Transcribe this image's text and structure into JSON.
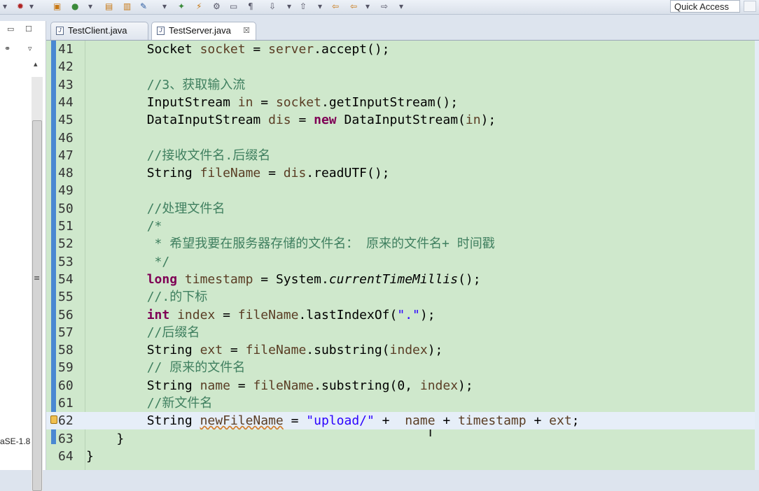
{
  "toolbar": {
    "quick_access": "Quick Access"
  },
  "tabs": [
    {
      "label": "TestClient.java"
    },
    {
      "label": "TestServer.java",
      "close": "☒"
    }
  ],
  "left_panel_text": "aSE-1.8",
  "code_lines": [
    {
      "num": "41",
      "tokens": [
        {
          "t": "        Socket ",
          "c": ""
        },
        {
          "t": "socket",
          "c": "fld"
        },
        {
          "t": " = ",
          "c": ""
        },
        {
          "t": "server",
          "c": "fld"
        },
        {
          "t": ".accept();",
          "c": ""
        }
      ]
    },
    {
      "num": "42",
      "tokens": []
    },
    {
      "num": "43",
      "tokens": [
        {
          "t": "        //3、获取输入流",
          "c": "cm"
        }
      ]
    },
    {
      "num": "44",
      "tokens": [
        {
          "t": "        InputStream ",
          "c": ""
        },
        {
          "t": "in",
          "c": "fld"
        },
        {
          "t": " = ",
          "c": ""
        },
        {
          "t": "socket",
          "c": "fld"
        },
        {
          "t": ".getInputStream();",
          "c": ""
        }
      ]
    },
    {
      "num": "45",
      "tokens": [
        {
          "t": "        DataInputStream ",
          "c": ""
        },
        {
          "t": "dis",
          "c": "fld"
        },
        {
          "t": " = ",
          "c": ""
        },
        {
          "t": "new",
          "c": "kw"
        },
        {
          "t": " DataInputStream(",
          "c": ""
        },
        {
          "t": "in",
          "c": "fld"
        },
        {
          "t": ");",
          "c": ""
        }
      ]
    },
    {
      "num": "46",
      "tokens": []
    },
    {
      "num": "47",
      "tokens": [
        {
          "t": "        //接收文件名.后缀名",
          "c": "cm"
        }
      ]
    },
    {
      "num": "48",
      "tokens": [
        {
          "t": "        String ",
          "c": ""
        },
        {
          "t": "fileName",
          "c": "fld"
        },
        {
          "t": " = ",
          "c": ""
        },
        {
          "t": "dis",
          "c": "fld"
        },
        {
          "t": ".readUTF();",
          "c": ""
        }
      ]
    },
    {
      "num": "49",
      "tokens": []
    },
    {
      "num": "50",
      "tokens": [
        {
          "t": "        //处理文件名",
          "c": "cm"
        }
      ]
    },
    {
      "num": "51",
      "tokens": [
        {
          "t": "        /*",
          "c": "cm"
        }
      ]
    },
    {
      "num": "52",
      "tokens": [
        {
          "t": "         * 希望我要在服务器存储的文件名： 原来的文件名+ 时间戳",
          "c": "cm"
        }
      ]
    },
    {
      "num": "53",
      "tokens": [
        {
          "t": "         */",
          "c": "cm"
        }
      ]
    },
    {
      "num": "54",
      "tokens": [
        {
          "t": "        ",
          "c": ""
        },
        {
          "t": "long",
          "c": "kw"
        },
        {
          "t": " ",
          "c": ""
        },
        {
          "t": "timestamp",
          "c": "fld"
        },
        {
          "t": " = System.",
          "c": ""
        },
        {
          "t": "currentTimeMillis",
          "c": "ital"
        },
        {
          "t": "();",
          "c": ""
        }
      ]
    },
    {
      "num": "55",
      "tokens": [
        {
          "t": "        //.的下标",
          "c": "cm"
        }
      ]
    },
    {
      "num": "56",
      "tokens": [
        {
          "t": "        ",
          "c": ""
        },
        {
          "t": "int",
          "c": "kw"
        },
        {
          "t": " ",
          "c": ""
        },
        {
          "t": "index",
          "c": "fld"
        },
        {
          "t": " = ",
          "c": ""
        },
        {
          "t": "fileName",
          "c": "fld"
        },
        {
          "t": ".lastIndexOf(",
          "c": ""
        },
        {
          "t": "\".\"",
          "c": "str"
        },
        {
          "t": ");",
          "c": ""
        }
      ]
    },
    {
      "num": "57",
      "tokens": [
        {
          "t": "        //后缀名",
          "c": "cm"
        }
      ]
    },
    {
      "num": "58",
      "tokens": [
        {
          "t": "        String ",
          "c": ""
        },
        {
          "t": "ext",
          "c": "fld"
        },
        {
          "t": " = ",
          "c": ""
        },
        {
          "t": "fileName",
          "c": "fld"
        },
        {
          "t": ".substring(",
          "c": ""
        },
        {
          "t": "index",
          "c": "fld"
        },
        {
          "t": ");",
          "c": ""
        }
      ]
    },
    {
      "num": "59",
      "tokens": [
        {
          "t": "        // 原来的文件名",
          "c": "cm"
        }
      ]
    },
    {
      "num": "60",
      "tokens": [
        {
          "t": "        String ",
          "c": ""
        },
        {
          "t": "name",
          "c": "fld"
        },
        {
          "t": " = ",
          "c": ""
        },
        {
          "t": "fileName",
          "c": "fld"
        },
        {
          "t": ".substring(0, ",
          "c": ""
        },
        {
          "t": "index",
          "c": "fld"
        },
        {
          "t": ");",
          "c": ""
        }
      ]
    },
    {
      "num": "61",
      "tokens": [
        {
          "t": "        //新文件名",
          "c": "cm"
        }
      ]
    },
    {
      "num": "62",
      "current": true,
      "warning": true,
      "tokens": [
        {
          "t": "        String ",
          "c": ""
        },
        {
          "t": "newFileName",
          "c": "fld squig"
        },
        {
          "t": " = ",
          "c": ""
        },
        {
          "t": "\"upload/\"",
          "c": "str"
        },
        {
          "t": " +  ",
          "c": ""
        },
        {
          "t": "name",
          "c": "fld"
        },
        {
          "t": " + ",
          "c": ""
        },
        {
          "t": "timestamp",
          "c": "fld"
        },
        {
          "t": " + ",
          "c": ""
        },
        {
          "t": "ext",
          "c": "fld"
        },
        {
          "t": ";",
          "c": ""
        }
      ]
    },
    {
      "num": "63",
      "tokens": [
        {
          "t": "    }",
          "c": ""
        }
      ]
    },
    {
      "num": "64",
      "tokens": [
        {
          "t": "}",
          "c": ""
        }
      ]
    }
  ]
}
